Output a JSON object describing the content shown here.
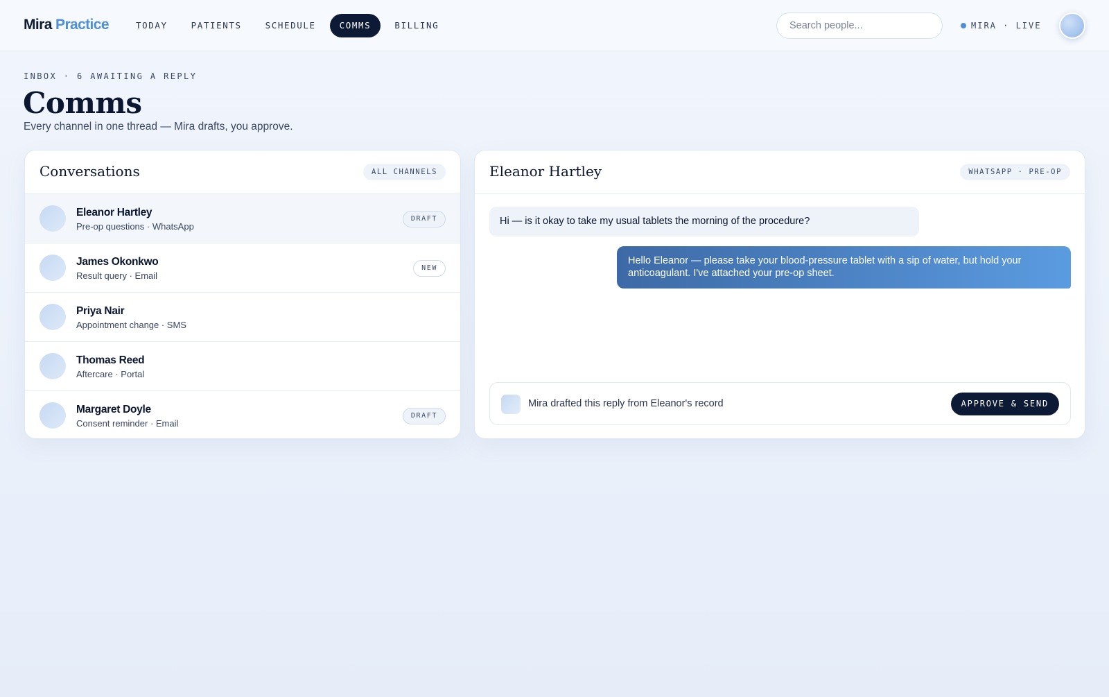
{
  "brand": {
    "part1": "Mira",
    "part2": "Practice"
  },
  "nav": {
    "items": [
      {
        "label": "TODAY"
      },
      {
        "label": "PATIENTS"
      },
      {
        "label": "SCHEDULE"
      },
      {
        "label": "COMMS"
      },
      {
        "label": "BILLING"
      }
    ],
    "active": "COMMS"
  },
  "search": {
    "placeholder": "Search people..."
  },
  "status": {
    "label": "MIRA · LIVE"
  },
  "header": {
    "eyebrow": "INBOX · 6 AWAITING A REPLY",
    "title": "Comms",
    "subtitle": "Every channel in one thread — Mira drafts, you approve."
  },
  "conversations": {
    "title": "Conversations",
    "filter": "ALL CHANNELS",
    "items": [
      {
        "name": "Eleanor Hartley",
        "subtitle": "Pre-op questions · WhatsApp",
        "badge": "DRAFT"
      },
      {
        "name": "James Okonkwo",
        "subtitle": "Result query · Email",
        "badge": "NEW"
      },
      {
        "name": "Priya Nair",
        "subtitle": "Appointment change · SMS",
        "badge": ""
      },
      {
        "name": "Thomas Reed",
        "subtitle": "Aftercare · Portal",
        "badge": ""
      },
      {
        "name": "Margaret Doyle",
        "subtitle": "Consent reminder · Email",
        "badge": "DRAFT"
      }
    ]
  },
  "thread": {
    "name": "Eleanor Hartley",
    "channel": "WHATSAPP · PRE-OP",
    "incoming": "Hi — is it okay to take my usual tablets the morning of the procedure?",
    "outgoing": "Hello Eleanor — please take your blood-pressure tablet with a sip of water, but hold your anticoagulant. I've attached your pre-op sheet.",
    "composer_note": "Mira drafted this reply from Eleanor's record",
    "approve_label": "APPROVE & SEND"
  },
  "colors": {
    "accent": "#4f8fd8",
    "navy": "#0d1a36",
    "background": "#eef3fa"
  }
}
